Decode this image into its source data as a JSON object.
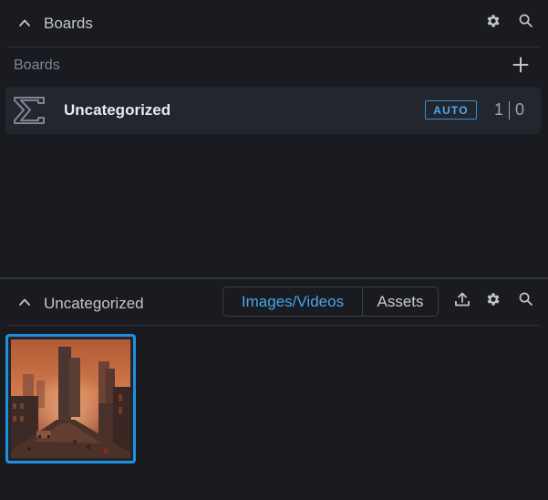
{
  "boards_panel": {
    "header_title": "Boards",
    "section_label": "Boards",
    "boards": [
      {
        "name": "Uncategorized",
        "badge": "AUTO",
        "image_count": "1",
        "asset_count": "0"
      }
    ]
  },
  "gallery_panel": {
    "header_title": "Uncategorized",
    "tabs": [
      {
        "label": "Images/Videos",
        "active": true
      },
      {
        "label": "Assets",
        "active": false
      }
    ],
    "thumbnails": [
      {
        "subject": "ruined-city-street-image",
        "selected": true
      }
    ]
  },
  "colors": {
    "background": "#1a1b20",
    "row_background": "#23262d",
    "accent": "#1f8fe0",
    "accent_text": "#45a4ee"
  },
  "icons": [
    "chevron-up-icon",
    "gear-icon",
    "search-icon",
    "plus-icon",
    "board-logo-icon",
    "upload-icon"
  ]
}
